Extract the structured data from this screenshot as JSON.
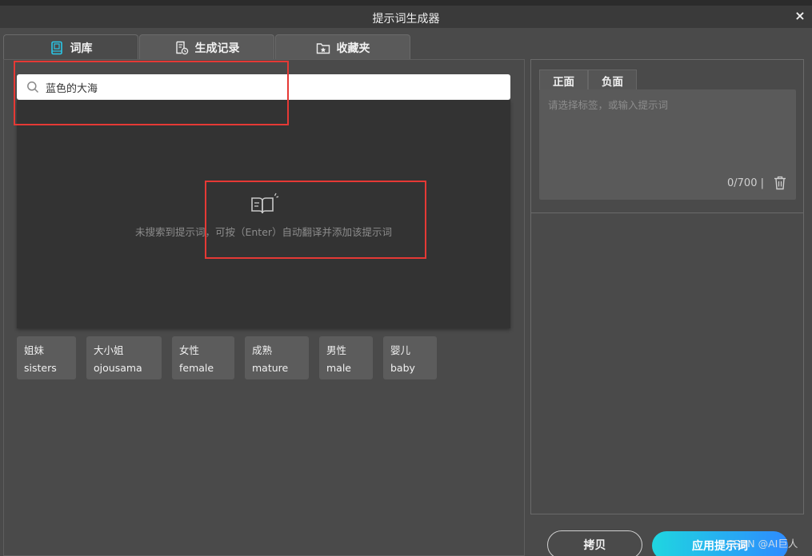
{
  "window": {
    "title": "提示词生成器",
    "close_label": "×"
  },
  "tabs": [
    {
      "label": "词库",
      "icon": "book-icon"
    },
    {
      "label": "生成记录",
      "icon": "history-icon"
    },
    {
      "label": "收藏夹",
      "icon": "favorites-folder-icon"
    }
  ],
  "search": {
    "value": "蓝色的大海",
    "placeholder": ""
  },
  "empty_state": {
    "message": "未搜索到提示词，可按（Enter）自动翻译并添加该提示词",
    "icon": "empty-book-icon"
  },
  "chips": [
    {
      "cn": "姐妹",
      "en": "sisters"
    },
    {
      "cn": "大小姐",
      "en": "ojousama"
    },
    {
      "cn": "女性",
      "en": "female"
    },
    {
      "cn": "成熟",
      "en": "mature"
    },
    {
      "cn": "男性",
      "en": "male"
    },
    {
      "cn": "婴儿",
      "en": "baby"
    }
  ],
  "prompt": {
    "tabs": [
      "正面",
      "负面"
    ],
    "placeholder": "请选择标签，或输入提示词",
    "counter": "0/700",
    "counter_sep": "|"
  },
  "buttons": {
    "copy": "拷贝",
    "apply": "应用提示词"
  },
  "watermark": "CSDN @AI巨人",
  "colors": {
    "accent_red": "#e53935",
    "apply_gradient_start": "#1fd6e0",
    "apply_gradient_end": "#2e8bff"
  }
}
